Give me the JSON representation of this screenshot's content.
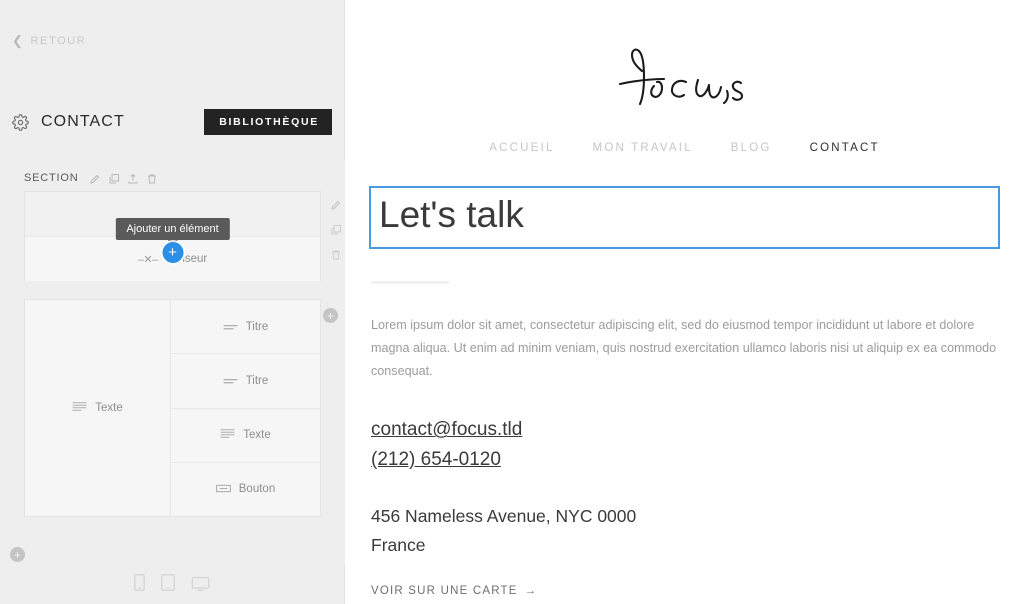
{
  "editor": {
    "back_label": "RETOUR",
    "page_title": "CONTACT",
    "library_button": "BIBLIOTHÈQUE",
    "section_label": "SECTION",
    "tooltip": "Ajouter un élément",
    "blocks": [
      {
        "elements": [
          {
            "label": "Diviseur",
            "icon": "divider-icon"
          }
        ]
      },
      {
        "left_cell": {
          "label": "Texte",
          "icon": "text-icon"
        },
        "right_cells": [
          {
            "label": "Titre",
            "icon": "heading-icon"
          },
          {
            "label": "Titre",
            "icon": "heading-icon"
          },
          {
            "label": "Texte",
            "icon": "text-icon"
          },
          {
            "label": "Bouton",
            "icon": "button-icon"
          }
        ]
      }
    ],
    "section_tools": [
      "edit-icon",
      "duplicate-icon",
      "export-icon",
      "delete-icon"
    ],
    "inner_tools": [
      "duplicate-icon",
      "export-icon",
      "delete-icon"
    ],
    "side_tools": [
      "edit-icon",
      "duplicate-icon",
      "delete-icon"
    ],
    "devices": [
      "mobile-icon",
      "tablet-icon",
      "desktop-icon"
    ],
    "accent_blue": "#2b8fe8",
    "panel_bg": "#eeeeee"
  },
  "site": {
    "logo_text": "focus",
    "nav": [
      {
        "label": "ACCUEIL",
        "active": false
      },
      {
        "label": "MON TRAVAIL",
        "active": false
      },
      {
        "label": "BLOG",
        "active": false
      },
      {
        "label": "CONTACT",
        "active": true
      }
    ],
    "headline": "Let's talk",
    "body": "Lorem ipsum dolor sit amet, consectetur adipiscing elit, sed do eiusmod tempor incididunt ut labore et dolore magna aliqua. Ut enim ad minim veniam, quis nostrud exercitation ullamco laboris nisi ut aliquip ex ea commodo consequat.",
    "email": "contact@focus.tld",
    "phone": "(212) 654-0120",
    "address_line1": "456 Nameless Avenue, NYC 0000",
    "address_line2": "France",
    "map_link": "VOIR SUR UNE CARTE",
    "selection_color": "#4a9ae0"
  }
}
